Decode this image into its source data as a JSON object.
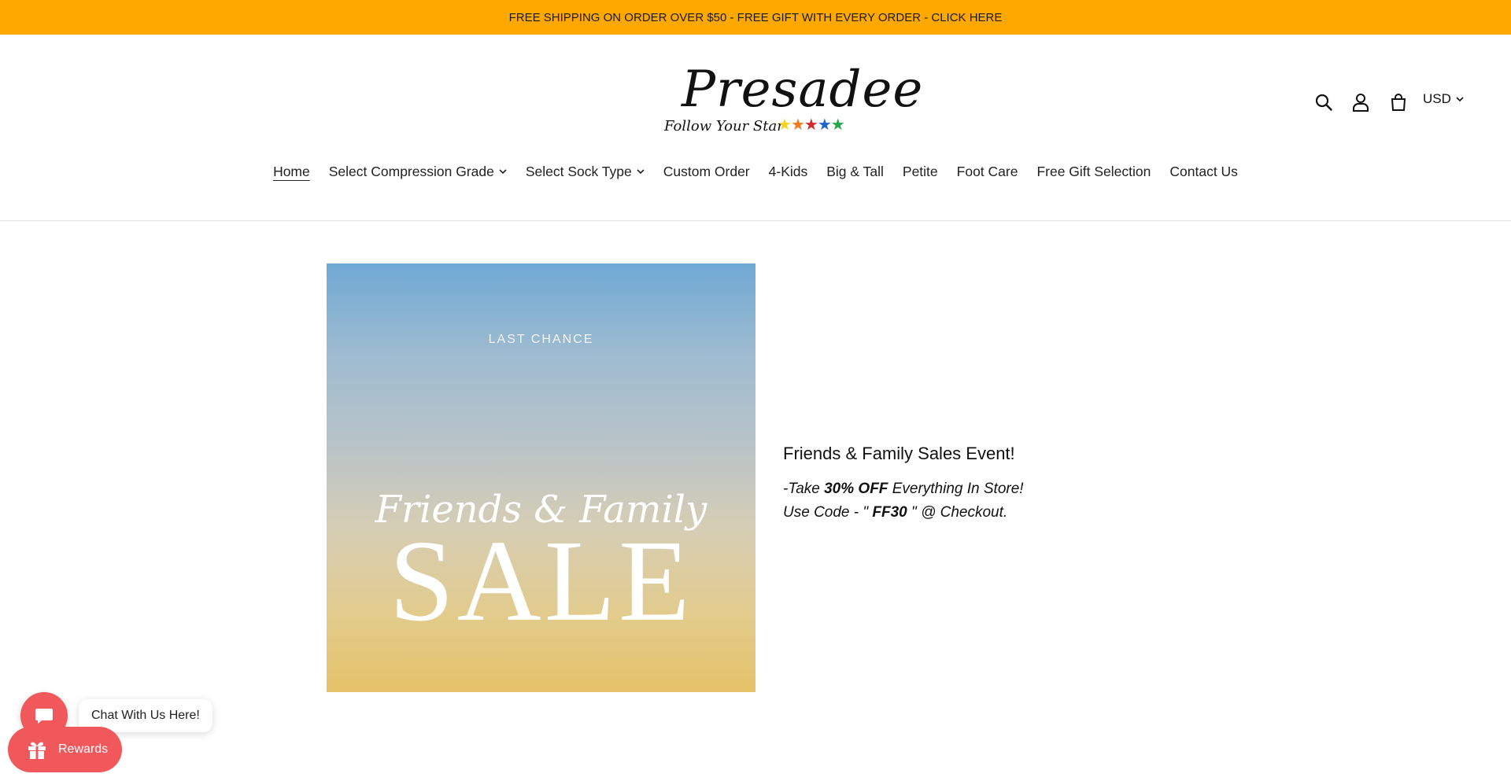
{
  "announcement": {
    "text": "FREE SHIPPING ON ORDER OVER $50 - FREE GIFT WITH EVERY ORDER - CLICK HERE"
  },
  "logo": {
    "name": "Presadee",
    "tagline": "Follow Your Star",
    "stars": [
      "#f5d21c",
      "#f07a1c",
      "#d42a2a",
      "#1b66c9",
      "#1ea84a"
    ]
  },
  "header_icons": [
    "search-icon",
    "account-icon",
    "cart-icon"
  ],
  "currency": {
    "selected": "USD"
  },
  "nav": [
    {
      "label": "Home",
      "active": true,
      "dropdown": false
    },
    {
      "label": "Select Compression Grade",
      "dropdown": true
    },
    {
      "label": "Select Sock Type",
      "dropdown": true
    },
    {
      "label": "Custom Order",
      "dropdown": false
    },
    {
      "label": "4-Kids",
      "dropdown": false
    },
    {
      "label": "Big & Tall",
      "dropdown": false
    },
    {
      "label": "Petite",
      "dropdown": false
    },
    {
      "label": "Foot Care",
      "dropdown": false
    },
    {
      "label": "Free Gift Selection",
      "dropdown": false
    },
    {
      "label": "Contact Us",
      "dropdown": false
    }
  ],
  "hero": {
    "image_kicker": "LAST CHANCE",
    "image_headline": "Friends & Family",
    "image_big": "SALE"
  },
  "promo": {
    "title": "Friends & Family Sales Event!",
    "line1_pre": "-Take ",
    "line1_bold": "30% OFF",
    "line1_post": " Everything In Store!",
    "line2_pre": "Use Code - \" ",
    "line2_bold": "FF30",
    "line2_post": " \" @ Checkout."
  },
  "chat": {
    "label": "Chat With Us Here!"
  },
  "rewards": {
    "label": "Rewards"
  },
  "colors": {
    "announcement_bg": "#ffa800",
    "widget_accent": "#f0585c"
  }
}
